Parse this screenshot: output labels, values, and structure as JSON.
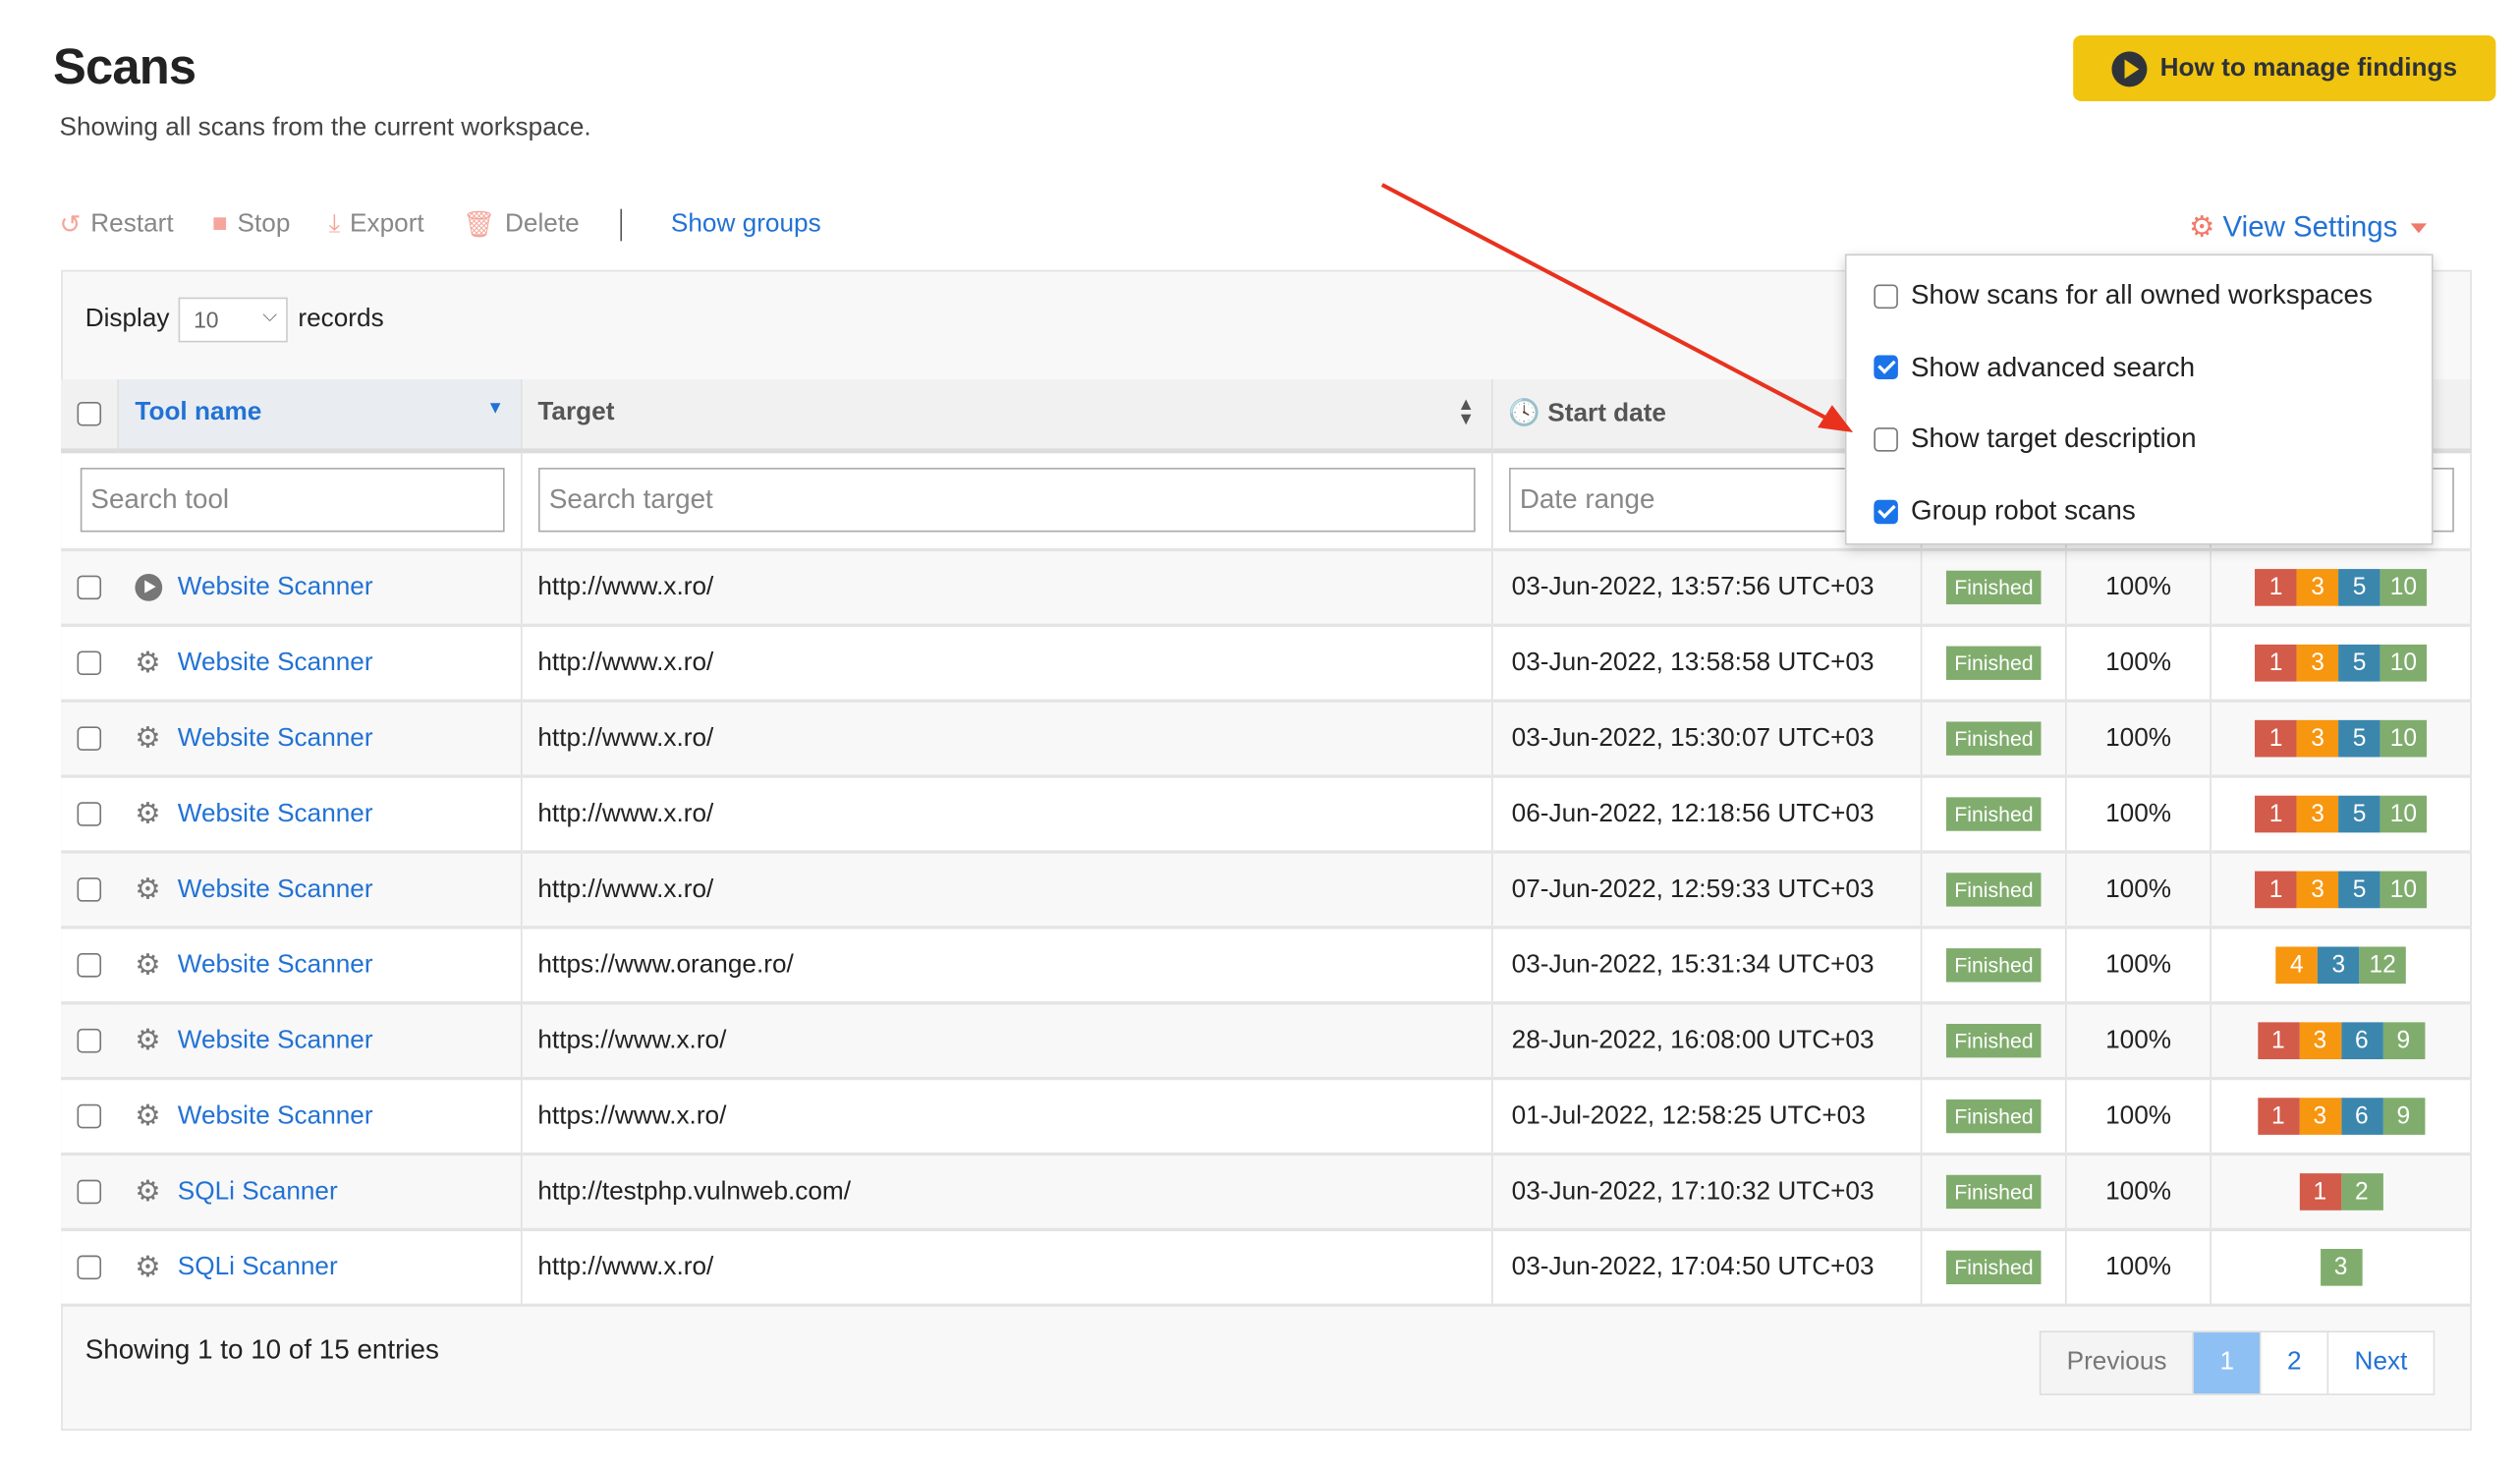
{
  "page": {
    "title": "Scans",
    "subtitle": "Showing all scans from the current workspace.",
    "help_button": "How to manage findings"
  },
  "toolbar": {
    "restart": "Restart",
    "stop": "Stop",
    "export": "Export",
    "delete": "Delete",
    "show_groups": "Show groups",
    "view_settings": "View Settings"
  },
  "display": {
    "label": "Display",
    "value": "10",
    "suffix": "records"
  },
  "table": {
    "headers": {
      "tool": "Tool name",
      "target": "Target",
      "start": "Start date"
    },
    "filters": {
      "tool": "Search tool",
      "target": "Search target",
      "date": "Date range"
    },
    "rows": [
      {
        "icon": "play",
        "tool": "Website Scanner",
        "target": "http://www.x.ro/",
        "date": "03-Jun-2022, 13:57:56 UTC+03",
        "status": "Finished",
        "progress": "100%",
        "findings": [
          [
            "1",
            "critical"
          ],
          [
            "3",
            "high"
          ],
          [
            "5",
            "medium"
          ],
          [
            "10",
            "low"
          ]
        ]
      },
      {
        "icon": "gear",
        "tool": "Website Scanner",
        "target": "http://www.x.ro/",
        "date": "03-Jun-2022, 13:58:58 UTC+03",
        "status": "Finished",
        "progress": "100%",
        "findings": [
          [
            "1",
            "critical"
          ],
          [
            "3",
            "high"
          ],
          [
            "5",
            "medium"
          ],
          [
            "10",
            "low"
          ]
        ]
      },
      {
        "icon": "gear",
        "tool": "Website Scanner",
        "target": "http://www.x.ro/",
        "date": "03-Jun-2022, 15:30:07 UTC+03",
        "status": "Finished",
        "progress": "100%",
        "findings": [
          [
            "1",
            "critical"
          ],
          [
            "3",
            "high"
          ],
          [
            "5",
            "medium"
          ],
          [
            "10",
            "low"
          ]
        ]
      },
      {
        "icon": "gear",
        "tool": "Website Scanner",
        "target": "http://www.x.ro/",
        "date": "06-Jun-2022, 12:18:56 UTC+03",
        "status": "Finished",
        "progress": "100%",
        "findings": [
          [
            "1",
            "critical"
          ],
          [
            "3",
            "high"
          ],
          [
            "5",
            "medium"
          ],
          [
            "10",
            "low"
          ]
        ]
      },
      {
        "icon": "gear",
        "tool": "Website Scanner",
        "target": "http://www.x.ro/",
        "date": "07-Jun-2022, 12:59:33 UTC+03",
        "status": "Finished",
        "progress": "100%",
        "findings": [
          [
            "1",
            "critical"
          ],
          [
            "3",
            "high"
          ],
          [
            "5",
            "medium"
          ],
          [
            "10",
            "low"
          ]
        ]
      },
      {
        "icon": "gear",
        "tool": "Website Scanner",
        "target": "https://www.orange.ro/",
        "date": "03-Jun-2022, 15:31:34 UTC+03",
        "status": "Finished",
        "progress": "100%",
        "findings": [
          [
            "4",
            "high"
          ],
          [
            "3",
            "medium"
          ],
          [
            "12",
            "low"
          ]
        ]
      },
      {
        "icon": "gear",
        "tool": "Website Scanner",
        "target": "https://www.x.ro/",
        "date": "28-Jun-2022, 16:08:00 UTC+03",
        "status": "Finished",
        "progress": "100%",
        "findings": [
          [
            "1",
            "critical"
          ],
          [
            "3",
            "high"
          ],
          [
            "6",
            "medium"
          ],
          [
            "9",
            "low"
          ]
        ]
      },
      {
        "icon": "gear",
        "tool": "Website Scanner",
        "target": "https://www.x.ro/",
        "date": "01-Jul-2022, 12:58:25 UTC+03",
        "status": "Finished",
        "progress": "100%",
        "findings": [
          [
            "1",
            "critical"
          ],
          [
            "3",
            "high"
          ],
          [
            "6",
            "medium"
          ],
          [
            "9",
            "low"
          ]
        ]
      },
      {
        "icon": "gear",
        "tool": "SQLi Scanner",
        "target": "http://testphp.vulnweb.com/",
        "date": "03-Jun-2022, 17:10:32 UTC+03",
        "status": "Finished",
        "progress": "100%",
        "findings": [
          [
            "1",
            "critical"
          ],
          [
            "2",
            "low"
          ]
        ]
      },
      {
        "icon": "gear",
        "tool": "SQLi Scanner",
        "target": "http://www.x.ro/",
        "date": "03-Jun-2022, 17:04:50 UTC+03",
        "status": "Finished",
        "progress": "100%",
        "findings": [
          [
            "3",
            "low"
          ]
        ]
      }
    ]
  },
  "view_settings_menu": [
    {
      "label": "Show scans for all owned workspaces",
      "checked": false
    },
    {
      "label": "Show advanced search",
      "checked": true
    },
    {
      "label": "Show target description",
      "checked": false
    },
    {
      "label": "Group robot scans",
      "checked": true
    }
  ],
  "footer": {
    "info": "Showing 1 to 10 of 15 entries",
    "pages": [
      "Previous",
      "1",
      "2",
      "Next"
    ],
    "current_page": "1"
  },
  "colors": {
    "critical": "#d35b4a",
    "high": "#f7960f",
    "medium": "#3b86ad",
    "low": "#80ad6d",
    "status_finished": "#80ad6d",
    "accent": "#2272d4",
    "help_button": "#f1c40f",
    "annotation_arrow": "#e8321e"
  }
}
